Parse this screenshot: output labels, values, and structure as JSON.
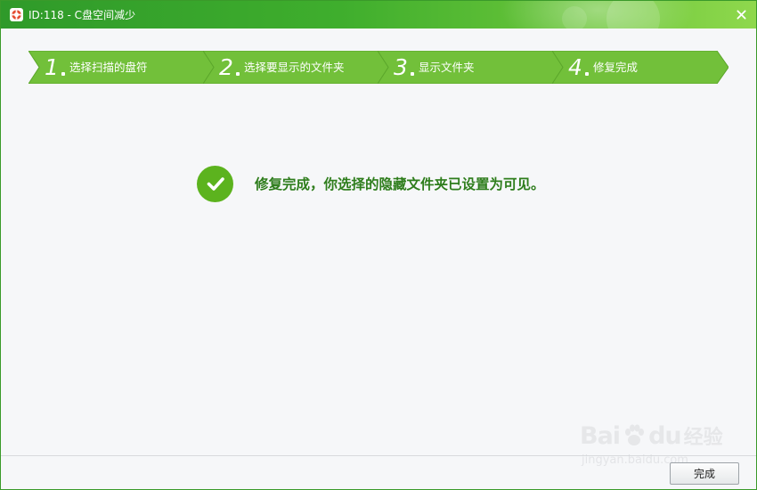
{
  "window": {
    "title": "ID:118 - C盘空间减少",
    "icon": "app-lifebuoy-icon",
    "close_icon": "close-icon"
  },
  "steps": [
    {
      "number": "1",
      "label": "选择扫描的盘符"
    },
    {
      "number": "2",
      "label": "选择要显示的文件夹"
    },
    {
      "number": "3",
      "label": "显示文件夹"
    },
    {
      "number": "4",
      "label": "修复完成"
    }
  ],
  "message": {
    "icon": "check-circle-icon",
    "text": "修复完成，你选择的隐藏文件夹已设置为可见。"
  },
  "footer": {
    "finish_label": "完成"
  },
  "watermark": {
    "logo_left": "Bai",
    "logo_right": "du",
    "logo_suffix": "经验",
    "url": "jingyan.baidu.com"
  },
  "colors": {
    "titlebar": "#3fae2d",
    "step_fill": "#72c03a",
    "message_text": "#2e7d1c",
    "check_fill": "#5cb31e"
  }
}
